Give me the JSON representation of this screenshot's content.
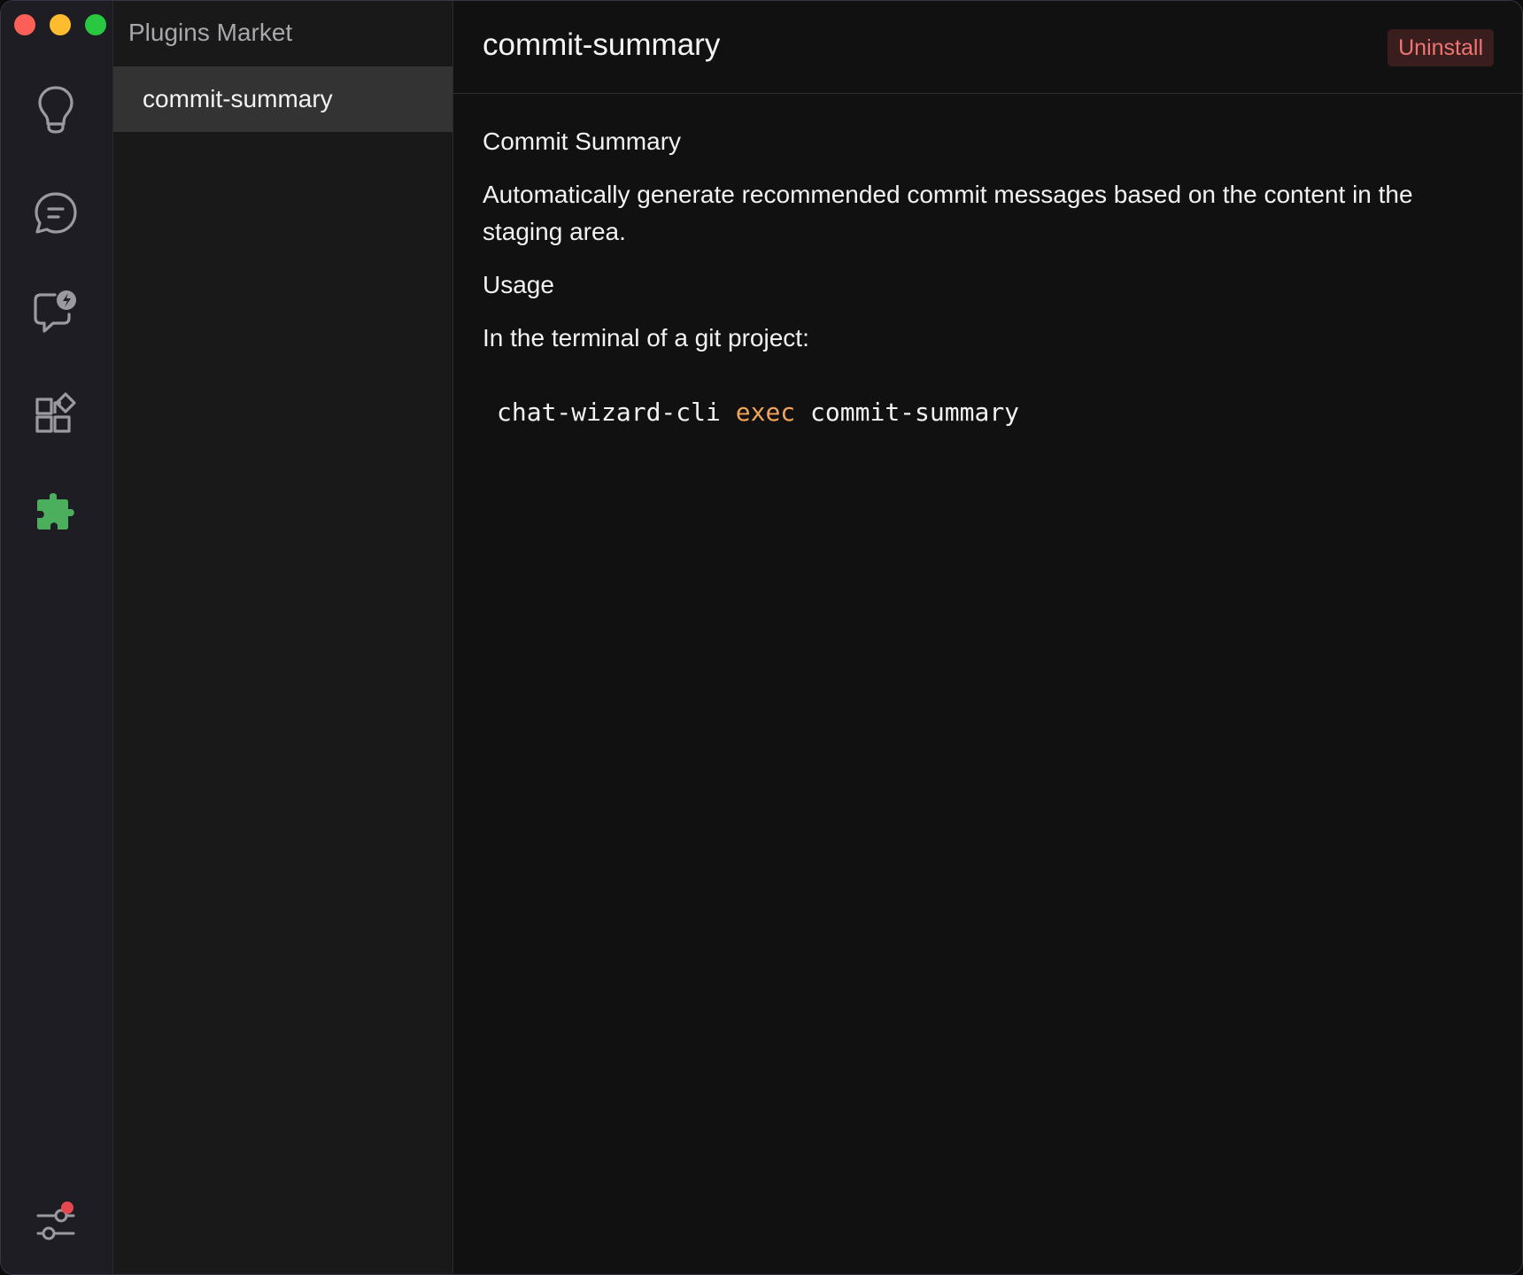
{
  "window": {
    "traffic_lights": [
      "close",
      "minimize",
      "zoom"
    ]
  },
  "activity_bar": {
    "items": [
      {
        "icon": "lightbulb-icon"
      },
      {
        "icon": "chat-bubble-icon"
      },
      {
        "icon": "chat-bolt-icon"
      },
      {
        "icon": "widgets-icon"
      },
      {
        "icon": "puzzle-icon",
        "active": true,
        "color": "#4caf5e"
      }
    ],
    "settings_icon": "settings-sliders-icon",
    "badge_color": "#e5484d"
  },
  "plugins_panel": {
    "title": "Plugins Market",
    "items": [
      {
        "label": "commit-summary",
        "selected": true
      }
    ]
  },
  "detail": {
    "title": "commit-summary",
    "uninstall_label": "Uninstall",
    "heading": "Commit Summary",
    "description": "Automatically generate recommended commit messages based on the content in the staging area.",
    "usage_heading": "Usage",
    "usage_text": "In the terminal of a git project:",
    "code": {
      "cmd": "chat-wizard-cli",
      "keyword": "exec",
      "arg": "commit-summary"
    }
  },
  "colors": {
    "accent_green": "#4caf5e",
    "danger": "#f07474",
    "code_keyword": "#f0a55c"
  }
}
